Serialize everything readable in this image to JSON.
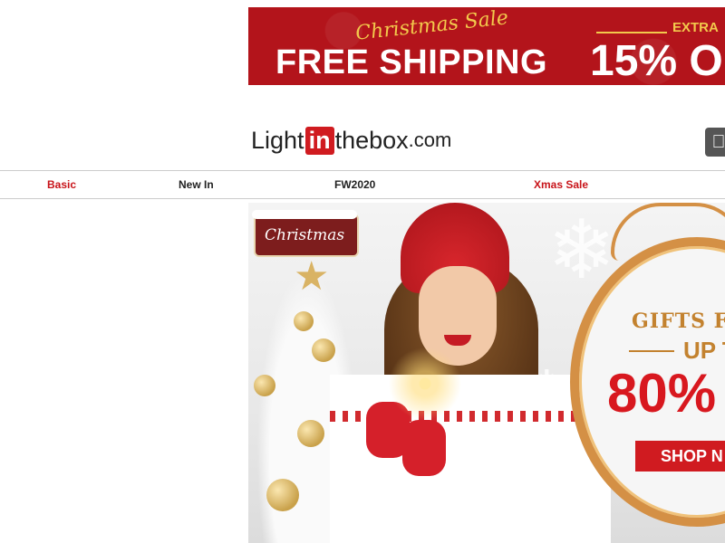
{
  "promo_banner": {
    "script_text": "Christmas Sale",
    "headline": "FREE SHIPPING",
    "extra_label": "EXTRA",
    "discount_text": "15% O"
  },
  "logo": {
    "part1": "Light",
    "part2": "in",
    "part3": "thebox",
    "part4": ".com"
  },
  "nav": {
    "items": [
      {
        "label": "Basic"
      },
      {
        "label": "New In"
      },
      {
        "label": "FW2020"
      },
      {
        "label": "Xmas Sale"
      }
    ]
  },
  "hero": {
    "sign_text": "Christmas",
    "gifts_text": "GIFTS FO",
    "up_to_text": "UP T",
    "percent_text": "80%",
    "button_label": "SHOP N"
  },
  "colors": {
    "brand_red": "#d01b20",
    "gold": "#d49045"
  }
}
